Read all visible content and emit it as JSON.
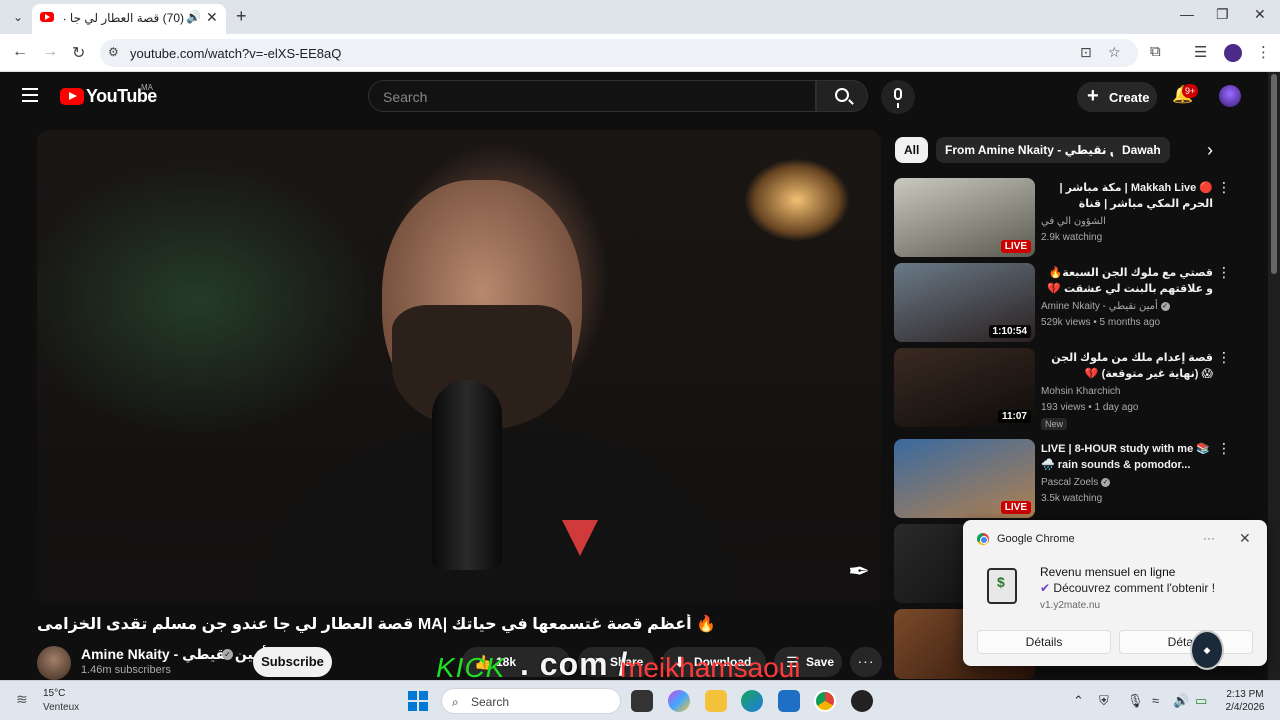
{
  "browser": {
    "tab_title": "(70) قصة العطار لي جا عندو",
    "new_tab": "+",
    "url": "youtube.com/watch?v=-elXS-EE8aQ"
  },
  "youtube": {
    "logo_text": "YouTube",
    "region": "MA",
    "search_placeholder": "Search",
    "create_label": "Create",
    "notification_count": "9+"
  },
  "video": {
    "title": "🔥 أعظم قصة غتسمعها في حياتك |MA قصة العطار لي جا عندو جن مسلم تقدى الخزامى",
    "channel": "Amine Nkaity - أمين نقيطي",
    "subscribers": "1.46m subscribers",
    "subscribe_label": "Subscribe",
    "likes": "18k",
    "share_label": "Share",
    "download_label": "Download",
    "save_label": "Save"
  },
  "chips": [
    "All",
    "From Amine Nkaity - أمين نقيطي",
    "Dawah"
  ],
  "recommendations": [
    {
      "title": "🔴 Makkah Live | مكة مباشر | الحرم المكي مباشر | قناة القرآن الكريم السعودية",
      "channel": "الشؤون الي في",
      "meta": "2.9k watching",
      "badge": "LIVE",
      "colors": [
        "#c9c9c0",
        "#5a5a50"
      ]
    },
    {
      "title": "قصتي مع ملوك الجن السبعة🔥 و علاقتهم بالبنت لي عشقت 💔",
      "channel": "Amine Nkaity - أمين نقيطي",
      "meta": "529k views • 5 months ago",
      "badge": "1:10:54",
      "colors": [
        "#6a7a88",
        "#2a2020"
      ]
    },
    {
      "title": "قصة إعدام ملك من ملوك الجن 😱 (نهاية غير متوقعة) 💔",
      "channel": "Mohsin Kharchich",
      "meta": "193 views • 1 day ago",
      "badge": "11:07",
      "tag": "New",
      "colors": [
        "#3a2a22",
        "#0e0c0a"
      ]
    },
    {
      "title": "LIVE | 8-HOUR study with me 📚🌧️ rain sounds & pomodor...",
      "channel": "Pascal Zoels",
      "meta": "3.5k watching",
      "badge": "LIVE",
      "colors": [
        "#3a6aa0",
        "#b08050"
      ]
    }
  ],
  "notification": {
    "app": "Google Chrome",
    "title": "Revenu mensuel en ligne",
    "body": "Découvrez comment l'obtenir !",
    "source": "v1.y2mate.nu",
    "button1": "Détails",
    "button2": "Détails"
  },
  "overlay": {
    "kick": "KICK",
    "domain": ". com /",
    "handle": "meikhamsaoui"
  },
  "taskbar": {
    "temperature": "15°C",
    "condition": "Venteux",
    "search_label": "Search",
    "time": "2:13 PM",
    "date": "2/4/2026"
  }
}
